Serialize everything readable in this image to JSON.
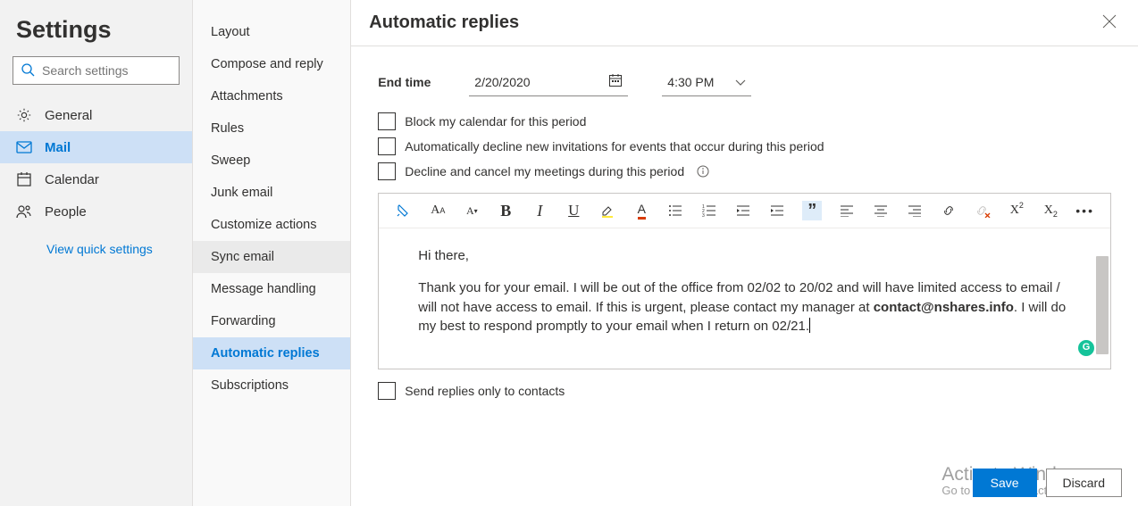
{
  "sidebar": {
    "title": "Settings",
    "search_placeholder": "Search settings",
    "nav": [
      {
        "label": "General"
      },
      {
        "label": "Mail"
      },
      {
        "label": "Calendar"
      },
      {
        "label": "People"
      }
    ],
    "quick_link": "View quick settings"
  },
  "mid": {
    "items": [
      "Layout",
      "Compose and reply",
      "Attachments",
      "Rules",
      "Sweep",
      "Junk email",
      "Customize actions",
      "Sync email",
      "Message handling",
      "Forwarding",
      "Automatic replies",
      "Subscriptions"
    ]
  },
  "panel": {
    "title": "Automatic replies",
    "end_time_label": "End time",
    "end_date": "2/20/2020",
    "end_time": "4:30 PM",
    "chk_block": "Block my calendar for this period",
    "chk_decline_new": "Automatically decline new invitations for events that occur during this period",
    "chk_decline_cancel": "Decline and cancel my meetings during this period",
    "editor_greeting": "Hi there,",
    "editor_line1_a": "Thank you for your email. I will be out of the office from 02/02 to 20/02 and will have limited access to email / will not have access to email. If this is urgent, please contact my manager at ",
    "editor_email": "contact@nshares.info",
    "editor_line1_b": ". I will do my best to respond promptly to your email when I return on 02/21.",
    "send_only_contacts": "Send replies only to contacts",
    "save": "Save",
    "discard": "Discard"
  },
  "watermark": {
    "title": "Activate Windows",
    "sub": "Go to Settings to activate Windows"
  }
}
